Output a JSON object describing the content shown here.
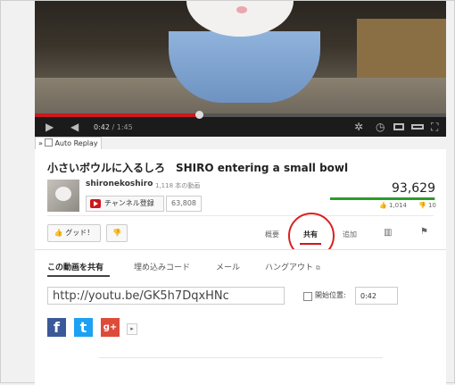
{
  "player": {
    "time_current": "0:42",
    "time_duration": "/ 1:45",
    "progress_fraction": 0.4,
    "auto_replay_label": "Auto Replay",
    "auto_replay_arrow": "»"
  },
  "video": {
    "title": "小さいボウルに入るしろ　SHIRO entering a small bowl",
    "channel": "shironekoshiro",
    "video_count": "1,118 本の動画",
    "subscribe_label": "チャンネル登録",
    "subscriber_count": "63,808",
    "views": "93,629",
    "likes": "1,014",
    "dislikes": "10",
    "like_ratio": 0.99,
    "like_ratio_color": "#2e9a2e"
  },
  "actions": {
    "like_label": "グッド！",
    "tabs": [
      {
        "label": "概要"
      },
      {
        "label": "共有"
      },
      {
        "label": "追加"
      }
    ],
    "active_tab": "共有",
    "accent_color": "#cc181e",
    "highlight_circle_color": "#d92121"
  },
  "share": {
    "tabs": [
      {
        "label": "この動画を共有"
      },
      {
        "label": "埋め込みコード"
      },
      {
        "label": "メール"
      },
      {
        "label": "ハングアウト"
      }
    ],
    "url": "http://youtu.be/GK5h7DqxHNc",
    "start_label": "開始位置:",
    "start_value": "0:42",
    "social": [
      {
        "name": "facebook",
        "glyph": "f",
        "color": "#3b5998"
      },
      {
        "name": "twitter",
        "glyph": "t",
        "color": "#1da1f2"
      },
      {
        "name": "google-plus",
        "glyph": "g+",
        "color": "#dd4b39"
      }
    ],
    "more_glyph": "▸"
  }
}
